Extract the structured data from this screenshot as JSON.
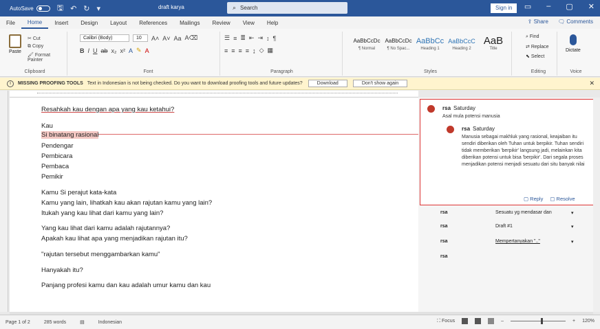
{
  "titlebar": {
    "autosave": "AutoSave",
    "autosave_state": "Off",
    "doc_title": "draft karya",
    "search_placeholder": "Search",
    "sign_in": "Sign in",
    "ribbon_display_icon": "ribbon-display-icon",
    "minimize": "–",
    "maximize": "▢",
    "close": "✕"
  },
  "tabs": {
    "items": [
      "File",
      "Home",
      "Insert",
      "Design",
      "Layout",
      "References",
      "Mailings",
      "Review",
      "View",
      "Help"
    ],
    "active": "Home",
    "share": "Share",
    "comments": "Comments"
  },
  "ribbon": {
    "clipboard": {
      "paste": "Paste",
      "cut": "Cut",
      "copy": "Copy",
      "format_painter": "Format Painter",
      "label": "Clipboard"
    },
    "font": {
      "font_name": "Calibri (Body)",
      "font_size": "10",
      "label": "Font"
    },
    "paragraph": {
      "label": "Paragraph"
    },
    "styles": {
      "label": "Styles",
      "items": [
        {
          "sample": "AaBbCcDc",
          "name": "¶ Normal"
        },
        {
          "sample": "AaBbCcDc",
          "name": "¶ No Spac..."
        },
        {
          "sample": "AaBbCc",
          "name": "Heading 1"
        },
        {
          "sample": "AaBbCcC",
          "name": "Heading 2"
        },
        {
          "sample": "AaB",
          "name": "Title"
        }
      ]
    },
    "editing": {
      "find": "Find",
      "replace": "Replace",
      "select": "Select",
      "label": "Editing"
    },
    "voice": {
      "dictate": "Dictate",
      "label": "Voice"
    }
  },
  "message_bar": {
    "title": "MISSING PROOFING TOOLS",
    "text": "Text in Indonesian is not being checked. Do you want to download proofing tools and future updates?",
    "download": "Download",
    "dont_show": "Don't show again"
  },
  "document": {
    "lines": [
      "Resahkah kau dengan apa yang kau ketahui?",
      "Kau",
      "Si binatang rasional",
      "Pendengar",
      "Pembicara",
      "Pembaca",
      "Pemikir",
      "Kamu Si perajut kata-kata",
      "Kamu yang lain, lihatkah kau akan rajutan kamu yang lain?",
      "Itukah yang kau lihat dari kamu yang lain?",
      "Yang kau lihat dari kamu adalah rajutannya?",
      "Apakah kau lihat apa yang menjadikan rajutan itu?",
      "\"rajutan tersebut menggambarkan kamu\"",
      "Hanyakah itu?",
      "Panjang profesi kamu dan kau adalah umur kamu dan kau"
    ]
  },
  "comments": {
    "active": {
      "author": "rsa",
      "time": "Saturday",
      "text": "Asal mula potensi manusia",
      "reply_author": "rsa",
      "reply_time": "Saturday",
      "reply_text": "Manusia sebagai makhluk yang rasional, keajaiban itu sendiri diberikan oleh Tuhan untuk berpikir. Tuhan sendiri tidak memberikan 'berpikir' langsung jadi, melainkan kita diberikan potensi untuk bisa 'berpikir'. Dari segala proses menjadikan potensi menjadi sesuatu dari situ banyak nilai",
      "reply": "Reply",
      "resolve": "Resolve"
    },
    "others": [
      {
        "author": "rsa",
        "text": "Sesuatu yg mendasar dan"
      },
      {
        "author": "rsa",
        "text": "Draft #1"
      },
      {
        "author": "rsa",
        "text": "Mempertanyakan \"..\""
      },
      {
        "author": "rsa",
        "text": ""
      }
    ]
  },
  "status": {
    "page": "Page 1 of 2",
    "words": "285 words",
    "language": "Indonesian",
    "focus": "Focus",
    "zoom": "120%"
  }
}
